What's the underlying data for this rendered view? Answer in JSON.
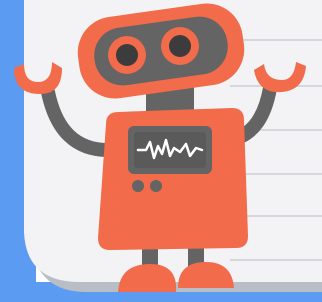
{
  "illustration": {
    "subject": "robot-mascot",
    "colors": {
      "sidebar_blue": "#5b9cf2",
      "page_paper": "#f3f3f5",
      "ruled_line": "#d5d7dc",
      "page_shadow": "#b8bdc6",
      "robot_orange": "#f26b4a",
      "robot_gray": "#646464",
      "robot_dark": "#3c3c3c",
      "screen_bg": "#5a5a5a",
      "screen_wave": "#ffffff",
      "eye_white": "#fde9e3"
    },
    "parts": [
      "head",
      "eyes",
      "neck",
      "arms",
      "hands",
      "body",
      "screen",
      "buttons",
      "legs",
      "feet"
    ]
  }
}
